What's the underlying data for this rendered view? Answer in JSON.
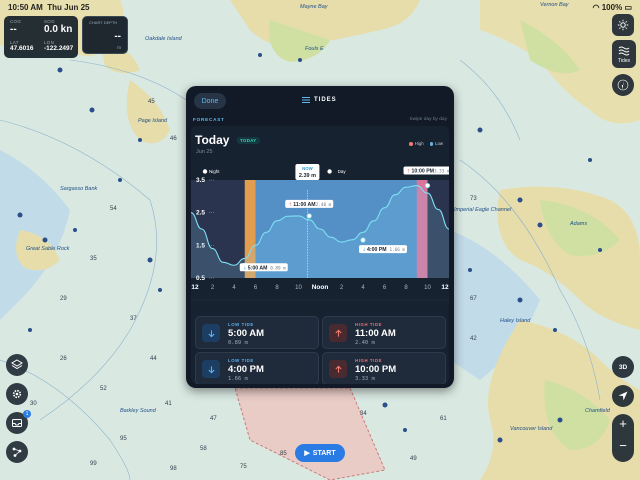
{
  "status_bar": {
    "time": "10:50 AM",
    "date": "Thu Jun 25",
    "battery": "100%"
  },
  "instruments": {
    "cog": {
      "label": "COG",
      "value": "--"
    },
    "sog": {
      "label": "SOG",
      "value": "0.0 kn"
    },
    "lat": {
      "label": "LAT",
      "value": "47.6016"
    },
    "lon": {
      "label": "LON",
      "value": "-122.2497"
    },
    "chart_depth": {
      "label": "CHART DEPTH",
      "value": "--",
      "unit": "m"
    }
  },
  "map_labels": {
    "place1": "Oakdale Island",
    "place2": "Page Island",
    "place3": "Sargasso Bank",
    "place4": "Great Sable Rock",
    "place5": "Imperial Eagle Channel",
    "place6": "Barkley Sound",
    "place7": "Vancouver Island",
    "place8": "Haley Island",
    "place9": "Adams",
    "place10": "Mayne Bay",
    "place11": "Vernon Bay",
    "place12": "Fouls E",
    "place13": "Chamfield"
  },
  "depth_numbers": [
    "45",
    "46",
    "54",
    "35",
    "29",
    "37",
    "44",
    "26",
    "52",
    "41",
    "47",
    "58",
    "75",
    "85",
    "95",
    "73",
    "67",
    "42",
    "49",
    "99",
    "61",
    "34",
    "30",
    "98"
  ],
  "panel": {
    "done_label": "Done",
    "title": "TIDES",
    "forecast_label": "FORECAST",
    "swipe_hint": "Swipe day by day",
    "day_title": "Today",
    "today_badge": "TODAY",
    "date": "Jun 25",
    "legend_high": "High",
    "legend_low": "Low"
  },
  "chart_data": {
    "type": "line",
    "title": "Today",
    "subtitle": "Jun 25",
    "ylabel": "",
    "y_ticks": [
      "3.5",
      "2.5",
      "1.5",
      "0.5"
    ],
    "ylim": [
      0.5,
      3.5
    ],
    "x_tick_labels": [
      "12",
      "2",
      "4",
      "6",
      "8",
      "10",
      "Noon",
      "2",
      "4",
      "6",
      "8",
      "10",
      "12"
    ],
    "x_hours": [
      0,
      2,
      4,
      6,
      8,
      10,
      12,
      14,
      16,
      18,
      20,
      22,
      24
    ],
    "xlim": [
      0,
      24
    ],
    "series": [
      {
        "x": [
          0,
          1,
          2,
          3,
          4,
          5,
          6,
          7,
          8,
          9,
          10,
          11,
          12,
          13,
          14,
          15,
          16,
          17,
          18,
          19,
          20,
          21,
          22,
          23,
          24
        ],
        "y": [
          2.5,
          2.0,
          1.4,
          0.98,
          0.89,
          1.1,
          1.5,
          1.9,
          2.25,
          2.39,
          2.4,
          2.28,
          2.0,
          1.75,
          1.6,
          1.67,
          1.9,
          2.25,
          2.65,
          3.05,
          3.28,
          3.33,
          3.1,
          2.6,
          2.0
        ]
      }
    ],
    "day_night": [
      {
        "label": "Night",
        "start": 0,
        "end": 5.3
      },
      {
        "label": "Day",
        "start": 5.3,
        "end": 21.6
      },
      {
        "label": "Night",
        "start": 21.6,
        "end": 24
      }
    ],
    "sunrise": [
      5.0,
      6.0
    ],
    "sunset": [
      21.0,
      22.0
    ],
    "now": {
      "label": "NOW",
      "x": 10.83,
      "value": "2.39 m"
    },
    "annotations": [
      {
        "time": "5:00 AM",
        "height": "0.89 m",
        "x": 5,
        "y": 0.89,
        "kind": "low"
      },
      {
        "time": "11:00 AM",
        "height": "2.40 m",
        "x": 11,
        "y": 2.4,
        "kind": "high"
      },
      {
        "time": "4:00 PM",
        "height": "1.66 m",
        "x": 16,
        "y": 1.66,
        "kind": "low"
      },
      {
        "time": "10:00 PM",
        "height": "3.33 m",
        "x": 22,
        "y": 3.33,
        "kind": "high"
      }
    ],
    "grid": false,
    "colors": {
      "night": "#2a344e",
      "day": "#5fa3e0",
      "sunrise": "#e29d4f",
      "sunset": "#d9759a",
      "line": "#7fe0f4",
      "high": "#ef7a6f",
      "low": "#5fb0ef"
    }
  },
  "tide_list": [
    {
      "type": "LOW TIDE",
      "time": "5:00 AM",
      "height": "0.89 m",
      "kind": "low"
    },
    {
      "type": "HIGH TIDE",
      "time": "11:00 AM",
      "height": "2.40 m",
      "kind": "high"
    },
    {
      "type": "LOW TIDE",
      "time": "4:00 PM",
      "height": "1.66 m",
      "kind": "low"
    },
    {
      "type": "HIGH TIDE",
      "time": "10:00 PM",
      "height": "3.33 m",
      "kind": "high"
    }
  ],
  "buttons": {
    "start": "START",
    "tides": "Tides",
    "view_3d": "3D",
    "zoom_in": "+",
    "zoom_out": "−",
    "badge_count": "1"
  }
}
